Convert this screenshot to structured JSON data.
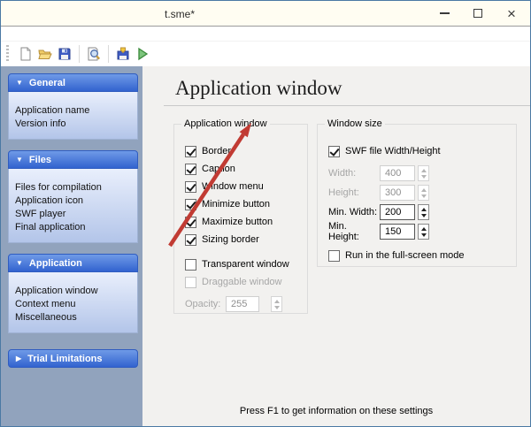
{
  "window": {
    "title": "t.sme*"
  },
  "icons": {
    "close_glyph": "×",
    "expanded_arrow": "▼",
    "collapsed_arrow": "▶"
  },
  "toolbar": {
    "buttons": [
      "new-file",
      "open-file",
      "save-file",
      "preview",
      "compile",
      "run"
    ]
  },
  "sidebar": {
    "sections": [
      {
        "label": "General",
        "expanded": true,
        "items": [
          "Application name",
          "Version info"
        ]
      },
      {
        "label": "Files",
        "expanded": true,
        "items": [
          "Files for compilation",
          "Application icon",
          "SWF player",
          "Final application"
        ]
      },
      {
        "label": "Application",
        "expanded": true,
        "items": [
          "Application window",
          "Context menu",
          "Miscellaneous"
        ]
      },
      {
        "label": "Trial Limitations",
        "expanded": false,
        "items": []
      }
    ]
  },
  "main": {
    "heading": "Application window",
    "footer": "Press F1 to get information on these settings",
    "groups": {
      "app_window": {
        "title": "Application window",
        "checkboxes": [
          {
            "label": "Border",
            "checked": true,
            "disabled": false
          },
          {
            "label": "Caption",
            "checked": true,
            "disabled": false
          },
          {
            "label": "Window menu",
            "checked": true,
            "disabled": false
          },
          {
            "label": "Minimize button",
            "checked": true,
            "disabled": false
          },
          {
            "label": "Maximize button",
            "checked": true,
            "disabled": false
          },
          {
            "label": "Sizing border",
            "checked": true,
            "disabled": false
          },
          {
            "label": "Transparent window",
            "checked": false,
            "disabled": false
          },
          {
            "label": "Draggable window",
            "checked": false,
            "disabled": true
          }
        ],
        "opacity": {
          "label": "Opacity:",
          "value": "255",
          "disabled": true
        }
      },
      "window_size": {
        "title": "Window size",
        "swf_checkbox": {
          "label": "SWF file Width/Height",
          "checked": true
        },
        "fields": [
          {
            "label": "Width:",
            "value": "400",
            "disabled": true
          },
          {
            "label": "Height:",
            "value": "300",
            "disabled": true
          },
          {
            "label": "Min. Width:",
            "value": "200",
            "disabled": false
          },
          {
            "label": "Min. Height:",
            "value": "150",
            "disabled": false
          }
        ],
        "fullscreen_checkbox": {
          "label": "Run in the full-screen mode",
          "checked": false
        }
      }
    }
  },
  "annotation": {
    "type": "red-arrow",
    "points_at": "Application window group title"
  }
}
